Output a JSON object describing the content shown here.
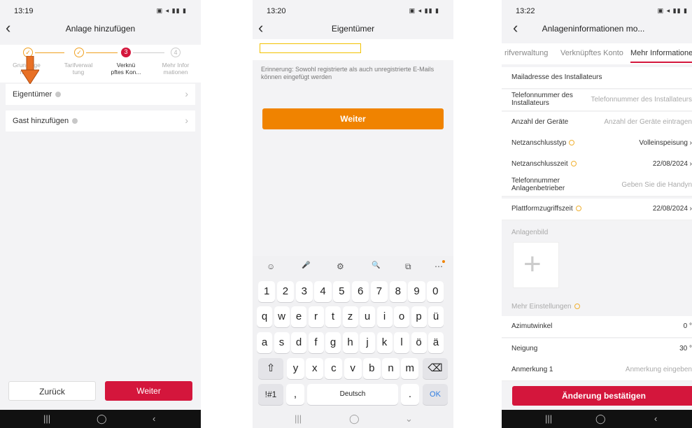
{
  "phone1": {
    "time": "13:19",
    "status_icons": "▣ ◂ ▮▮ ▮",
    "title": "Anlage hinzufügen",
    "steps": [
      {
        "label": "Grundlage\nnden",
        "state": "done"
      },
      {
        "label": "Tarifverwal\ntung",
        "state": "done"
      },
      {
        "label": "Verknü\npftes Kon...",
        "state": "active",
        "num": "3"
      },
      {
        "label": "Mehr Infor\nmationen",
        "state": "todo",
        "num": "4"
      }
    ],
    "rows": [
      "Eigentümer",
      "Gast hinzufügen"
    ],
    "back_button": "Zurück",
    "next_button": "Weiter",
    "accent_color": "#d4163c"
  },
  "phone2": {
    "time": "13:20",
    "status_icons": "▣ ◂ ▮▮ ▮",
    "title": "Eigentümer",
    "hint": "Erinnerung: Sowohl registrierte als auch unregistrierte E-Mails können eingefügt werden",
    "next_button": "Weiter",
    "button_color": "#f08300",
    "keyboard": {
      "tools": [
        "☺",
        "🎤",
        "⚙",
        "🔍",
        "⧉",
        "⋯"
      ],
      "row_digits": [
        "1",
        "2",
        "3",
        "4",
        "5",
        "6",
        "7",
        "8",
        "9",
        "0"
      ],
      "row1": [
        "q",
        "w",
        "e",
        "r",
        "t",
        "z",
        "u",
        "i",
        "o",
        "p",
        "ü"
      ],
      "row2": [
        "a",
        "s",
        "d",
        "f",
        "g",
        "h",
        "j",
        "k",
        "l",
        "ö",
        "ä"
      ],
      "row3": [
        "y",
        "x",
        "c",
        "v",
        "b",
        "n",
        "m"
      ],
      "shift": "⇧",
      "backspace": "⌫",
      "symbols": "!#1",
      "comma": ",",
      "space": "Deutsch",
      "period": ".",
      "ok": "OK"
    }
  },
  "phone3": {
    "time": "13:22",
    "status_icons": "▣ ◂ ▮▮ ▮",
    "title": "Anlageninformationen mo...",
    "tabs": [
      "rifverwaltung",
      "Verknüpftes Konto",
      "Mehr Informationen"
    ],
    "fields": [
      {
        "label": "Mailadresse des Installateurs",
        "value": "",
        "placeholder": true
      },
      {
        "label": "Telefonnummer des\nInstallateurs",
        "value": "Telefonnummer des Installateurs",
        "placeholder": true
      },
      {
        "label": "Anzahl der Geräte",
        "value": "Anzahl der Geräte eintragen",
        "placeholder": true
      },
      {
        "label": "Netzanschlusstyp",
        "value": "Volleinspeisung  ›",
        "placeholder": false,
        "help": true
      },
      {
        "label": "Netzanschlusszeit",
        "value": "22/08/2024  ›",
        "placeholder": false,
        "help": true
      },
      {
        "label": "Telefonnummer\nAnlagenbetrieber",
        "value": "Geben Sie die Handyn",
        "placeholder": true
      },
      {
        "label": "Plattformzugriffszeit",
        "value": "22/08/2024  ›",
        "placeholder": false,
        "help": true
      }
    ],
    "image_section": "Anlagenbild",
    "add_symbol": "+",
    "more_settings": "Mehr Einstellungen",
    "fields2": [
      {
        "label": "Azimutwinkel",
        "value": "0 °",
        "placeholder": false
      },
      {
        "label": "Neigung",
        "value": "30 °",
        "placeholder": false
      },
      {
        "label": "Anmerkung 1",
        "value": "Anmerkung eingeben",
        "placeholder": true
      }
    ],
    "confirm_button": "Änderung bestätigen"
  },
  "navbar": {
    "recent": "|||",
    "home": "◯",
    "back": "‹",
    "down": "⌄"
  }
}
